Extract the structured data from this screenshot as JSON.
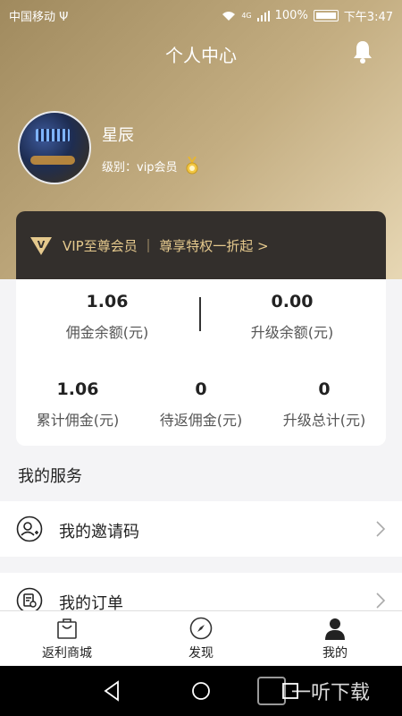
{
  "status_bar": {
    "carrier": "中国移动",
    "usb_symbol": "Ψ",
    "signal_hint": "4G",
    "battery": "100%",
    "time": "下午3:47"
  },
  "header": {
    "title": "个人中心"
  },
  "profile": {
    "username": "星辰",
    "level_text": "级别：vip会员"
  },
  "vip_banner": {
    "text": "VIP至尊会员 ｜ 尊享特权一折起 >"
  },
  "stats": {
    "commission_balance": {
      "value": "1.06",
      "label": "佣金余额(元)"
    },
    "upgrade_balance": {
      "value": "0.00",
      "label": "升级余额(元)"
    },
    "total_commission": {
      "value": "1.06",
      "label": "累计佣金(元)"
    },
    "pending_commission": {
      "value": "0",
      "label": "待返佣金(元)"
    },
    "upgrade_total": {
      "value": "0",
      "label": "升级总计(元)"
    }
  },
  "services": {
    "title": "我的服务",
    "items": [
      {
        "label": "我的邀请码",
        "icon": "invite-user-icon"
      },
      {
        "label": "我的订单",
        "icon": "order-icon"
      }
    ]
  },
  "tabbar": {
    "items": [
      {
        "label": "返利商城",
        "icon": "shopping-bag-icon"
      },
      {
        "label": "发现",
        "icon": "compass-icon"
      },
      {
        "label": "我的",
        "icon": "person-icon"
      }
    ]
  },
  "watermark": {
    "text": "一听下载"
  },
  "colors": {
    "gold_gradient_start": "#a08a5e",
    "gold_gradient_end": "#e7d7b4",
    "vip_card_bg": "#332f2c",
    "vip_text": "#e5c98d"
  }
}
